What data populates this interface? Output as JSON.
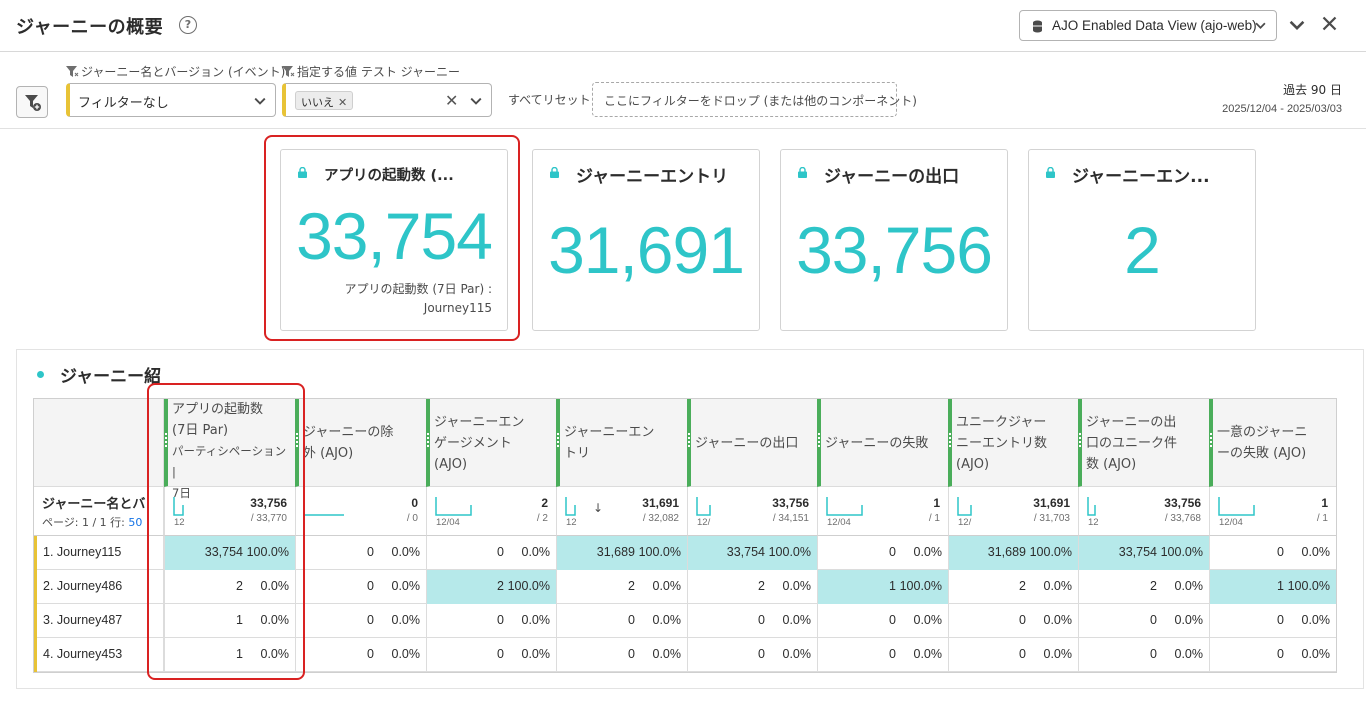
{
  "header": {
    "title": "ジャーニーの概要",
    "help_icon": "?",
    "data_view": "AJO Enabled Data View (ajo-web)"
  },
  "filters": {
    "filter1_label": "ジャーニー名とバージョン (イベント)",
    "filter1_value": "フィルターなし",
    "filter2_label": "指定する値 テスト ジャーニー",
    "filter2_tag": "いいえ",
    "reset": "すべてリセット",
    "dropzone": "ここにフィルターをドロップ (または他のコンポーネント)",
    "range_label": "過去 90 日",
    "range_dates": "2025/12/04 - 2025/03/03"
  },
  "kpis": [
    {
      "title": "アプリの起動数 (...",
      "value": "33,754",
      "sub1": "アプリの起動数 (7日 Par) :",
      "sub2": "Journey115"
    },
    {
      "title": "ジャーニーエントリ",
      "value": "31,691"
    },
    {
      "title": "ジャーニーの出口",
      "value": "33,756"
    },
    {
      "title": "ジャーニーエン...",
      "value": "2"
    }
  ],
  "panel": {
    "title": "ジャーニー紹",
    "dim_header": "ジャーニー名とバ",
    "page_info": "ページ: 1 / 1  行:",
    "rows_per_page": "50"
  },
  "columns": [
    {
      "l1": "アプリの起動数",
      "l2": "(7日 Par)",
      "l3": "パーティシペーション |",
      "l4": "7日",
      "total": "33,756",
      "pct": "/ 33,770",
      "spark": "12"
    },
    {
      "l1": "ジャーニーの除",
      "l2": "外 (AJO)",
      "total": "0",
      "pct": "/ 0",
      "spark": ""
    },
    {
      "l1": "ジャーニーエン",
      "l2": "ゲージメント",
      "l3": "(AJO)",
      "total": "2",
      "pct": "/ 2",
      "spark": "12/04"
    },
    {
      "l1": "ジャーニーエン",
      "l2": "トリ",
      "total": "31,691",
      "pct": "/ 32,082",
      "spark": "12"
    },
    {
      "l1": "ジャーニーの出口",
      "total": "33,756",
      "pct": "/ 34,151",
      "spark": "12/"
    },
    {
      "l1": "ジャーニーの失敗",
      "total": "1",
      "pct": "/ 1",
      "spark": "12/04"
    },
    {
      "l1": "ユニークジャー",
      "l2": "ニーエントリ数",
      "l3": "(AJO)",
      "total": "31,691",
      "pct": "/ 31,703",
      "spark": "12/"
    },
    {
      "l1": "ジャーニーの出",
      "l2": "口のユニーク件",
      "l3": "数 (AJO)",
      "total": "33,756",
      "pct": "/ 33,768",
      "spark": "12"
    },
    {
      "l1": "一意のジャーニ",
      "l2": "ーの失敗 (AJO)",
      "total": "1",
      "pct": "/ 1",
      "spark": "12/04"
    }
  ],
  "rows": [
    {
      "label": "1.  Journey115",
      "cells": [
        [
          "33,754",
          "100.0%",
          true
        ],
        [
          "0",
          "0.0%",
          false
        ],
        [
          "0",
          "0.0%",
          false
        ],
        [
          "31,689",
          "100.0%",
          true
        ],
        [
          "33,754",
          "100.0%",
          true
        ],
        [
          "0",
          "0.0%",
          false
        ],
        [
          "31,689",
          "100.0%",
          true
        ],
        [
          "33,754",
          "100.0%",
          true
        ],
        [
          "0",
          "0.0%",
          false
        ]
      ]
    },
    {
      "label": "2.  Journey486",
      "cells": [
        [
          "2",
          "0.0%",
          false
        ],
        [
          "0",
          "0.0%",
          false
        ],
        [
          "2",
          "100.0%",
          true
        ],
        [
          "2",
          "0.0%",
          false
        ],
        [
          "2",
          "0.0%",
          false
        ],
        [
          "1",
          "100.0%",
          true
        ],
        [
          "2",
          "0.0%",
          false
        ],
        [
          "2",
          "0.0%",
          false
        ],
        [
          "1",
          "100.0%",
          true
        ]
      ]
    },
    {
      "label": "3.  Journey487",
      "cells": [
        [
          "1",
          "0.0%",
          false
        ],
        [
          "0",
          "0.0%",
          false
        ],
        [
          "0",
          "0.0%",
          false
        ],
        [
          "0",
          "0.0%",
          false
        ],
        [
          "0",
          "0.0%",
          false
        ],
        [
          "0",
          "0.0%",
          false
        ],
        [
          "0",
          "0.0%",
          false
        ],
        [
          "0",
          "0.0%",
          false
        ],
        [
          "0",
          "0.0%",
          false
        ]
      ]
    },
    {
      "label": "4.  Journey453",
      "cells": [
        [
          "1",
          "0.0%",
          false
        ],
        [
          "0",
          "0.0%",
          false
        ],
        [
          "0",
          "0.0%",
          false
        ],
        [
          "0",
          "0.0%",
          false
        ],
        [
          "0",
          "0.0%",
          false
        ],
        [
          "0",
          "0.0%",
          false
        ],
        [
          "0",
          "0.0%",
          false
        ],
        [
          "0",
          "0.0%",
          false
        ],
        [
          "0",
          "0.0%",
          false
        ]
      ]
    }
  ],
  "colors": {
    "accent": "#2ec5c8",
    "highlight": "#b6e9ea",
    "column_bar": "#4aad5a",
    "row_marker": "#e8c336",
    "callout": "#d92222"
  }
}
